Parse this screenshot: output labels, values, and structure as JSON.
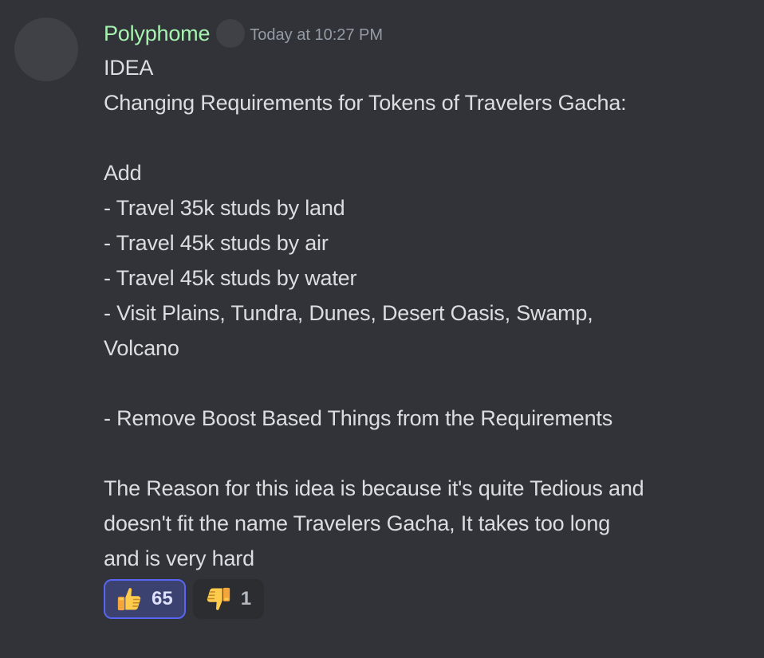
{
  "message": {
    "author": "Polyphome",
    "timestamp": "Today at 10:27 PM",
    "lines": [
      "IDEA",
      "Changing Requirements for Tokens of Travelers Gacha:",
      "",
      "Add",
      "- Travel 35k studs by land",
      "- Travel 45k studs by air",
      "- Travel 45k studs by water",
      "- Visit Plains, Tundra, Dunes, Desert Oasis, Swamp,",
      "Volcano",
      "",
      "- Remove Boost Based Things from the Requirements",
      "",
      "The Reason for this idea is because it's quite Tedious and",
      "doesn't fit the name Travelers Gacha, It takes too long",
      "and is very hard"
    ]
  },
  "reactions": [
    {
      "icon": "thumbs-up-icon",
      "count": "65",
      "reacted_by_me": true
    },
    {
      "icon": "thumbs-down-icon",
      "count": "1",
      "reacted_by_me": false
    }
  ],
  "colors": {
    "background": "#313338",
    "username": "#a6f3b0",
    "text": "#dbdee1",
    "timestamp": "#949ba4",
    "reaction_active_border": "#5865f2",
    "reaction_active_bg": "#3c4270",
    "reaction_inactive_bg": "#2b2d31"
  }
}
